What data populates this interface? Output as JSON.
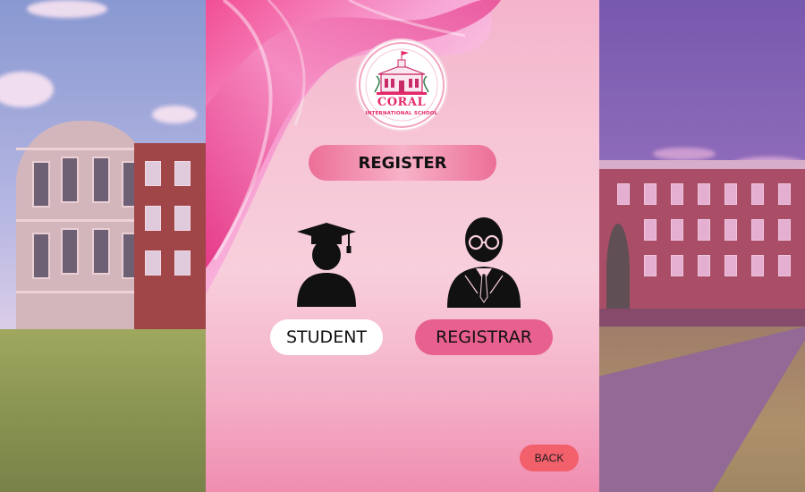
{
  "logo": {
    "name": "CORAL",
    "subtitle": "INTERNATIONAL SCHOOL",
    "icon": "school-building-icon"
  },
  "title": "REGISTER",
  "roles": [
    {
      "label": "STUDENT",
      "icon": "graduate-cap-icon"
    },
    {
      "label": "REGISTRAR",
      "icon": "elderly-man-glasses-icon"
    }
  ],
  "back_label": "BACK",
  "colors": {
    "accent_pink": "#e8608f",
    "title_pill": "#ec6f97",
    "back_button": "#f2606c",
    "logo_text": "#e5286a"
  }
}
